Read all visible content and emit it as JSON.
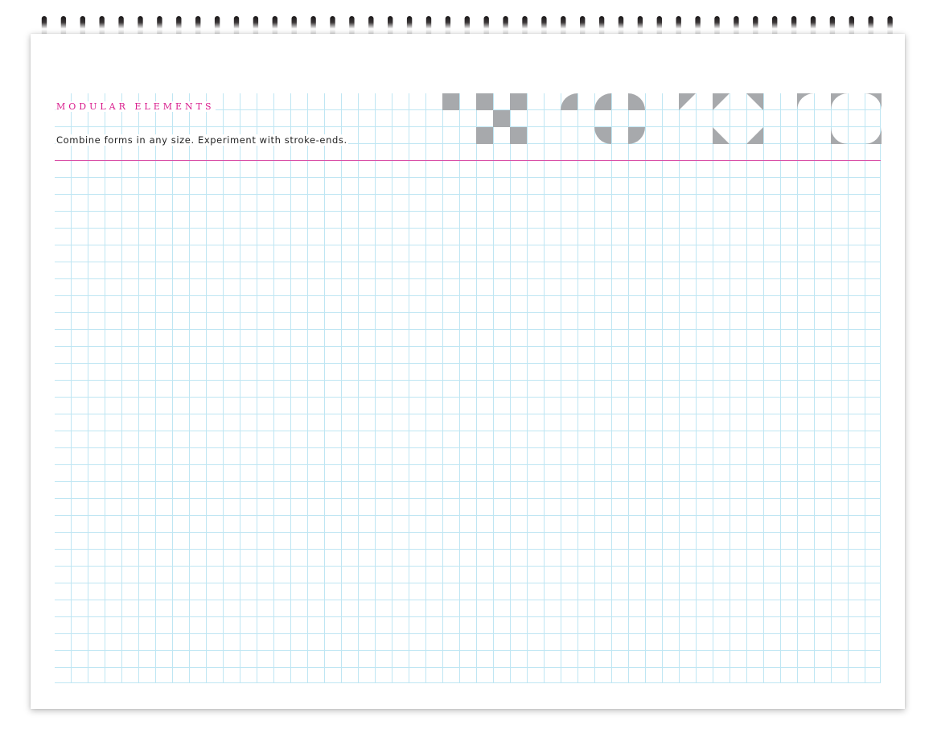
{
  "header": {
    "title": "MODULAR ELEMENTS",
    "subtitle": "Combine forms in any size. Experiment with stroke-ends."
  },
  "colors": {
    "accent": "#d81b8c",
    "rule": "#d94fa6",
    "grid": "#bfe6f3",
    "module_fill": "#a7a9ac",
    "binding": "#231f20"
  },
  "binding": {
    "ring_count": 45
  },
  "modules": [
    {
      "name": "checker-squares-module"
    },
    {
      "name": "rounded-quarters-module"
    },
    {
      "name": "triangle-corners-module"
    },
    {
      "name": "rounded-corners-module"
    }
  ]
}
